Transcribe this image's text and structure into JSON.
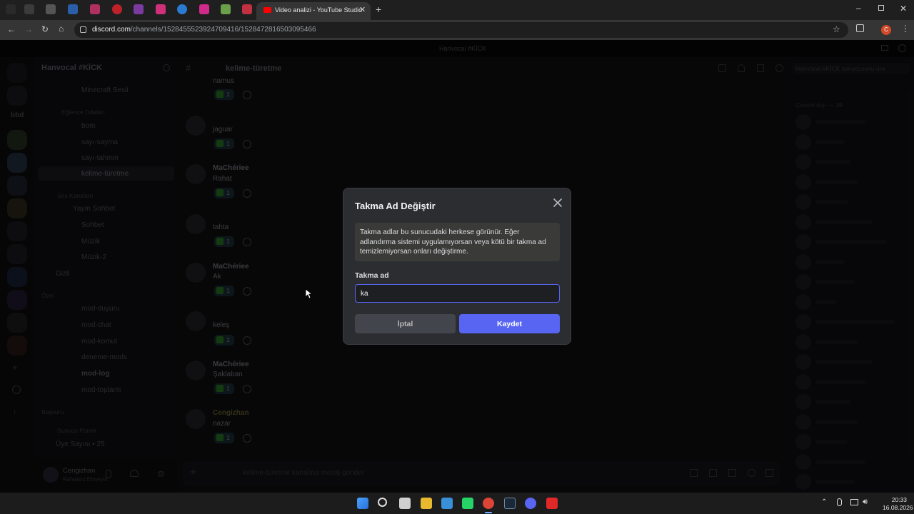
{
  "browser": {
    "active_tab_title": "Video analizi - YouTube Studio",
    "url_host": "discord.com",
    "url_path": "/channels/1528455523924709416/1528472816503095466",
    "profile_initial": "C"
  },
  "discord": {
    "window_title": "Hanvocal #KİCK",
    "server_name": "Hanvocal #KİCK",
    "current_channel": "kelime-türetme",
    "member_search_placeholder": "Hanvocal #KİCK sunucusunu ara",
    "channels": [
      {
        "label": "Minecraft Sesli"
      },
      {
        "label": "Eğlence Odaları"
      },
      {
        "label": "bom"
      },
      {
        "label": "sayı-sayma"
      },
      {
        "label": "sayı-tahmin"
      },
      {
        "label": "kelime-türetme"
      },
      {
        "label": "Ses Kanalları"
      },
      {
        "label": "Yayın Sohbet"
      },
      {
        "label": "Sohbet"
      },
      {
        "label": "Müzik"
      },
      {
        "label": "Müzik-2"
      },
      {
        "label": "Gizli"
      },
      {
        "label": "Özel"
      },
      {
        "label": "mod-duyuru"
      },
      {
        "label": "mod-chat"
      },
      {
        "label": "mod-komut"
      },
      {
        "label": "deneme-mods"
      },
      {
        "label": "mod-log"
      },
      {
        "label": "mod-toplantı"
      },
      {
        "label": "Başvuru"
      },
      {
        "label": "Sunucu Paneli"
      },
      {
        "label": "Üye Sayısı • 25"
      }
    ],
    "messages": [
      {
        "author": "",
        "text": "namus",
        "count": "1"
      },
      {
        "author": "",
        "text": "jaguar",
        "count": "1"
      },
      {
        "author": "MaChériee",
        "text": "Rahat",
        "count": "1"
      },
      {
        "author": "",
        "text": "tahta",
        "count": "1"
      },
      {
        "author": "MaChériee",
        "text": "Ak",
        "count": "1"
      },
      {
        "author": "",
        "text": "keleş",
        "count": "1"
      },
      {
        "author": "MaChériee",
        "text": "Şaklaban",
        "count": "1"
      },
      {
        "author": "Cengizhan",
        "text": "nazar",
        "count": "1"
      }
    ],
    "user": {
      "name": "Cengizhan",
      "status": "Rahatsız Etmeyin"
    },
    "members_header": "Çevrim dışı — 19",
    "message_placeholder": "kelime-türetme kanalına mesaj gönder"
  },
  "modal": {
    "title": "Takma Ad Değiştir",
    "notice": "Takma adlar bu sunucudaki herkese görünür. Eğer adlandırma sistemi uygulamıyorsan veya kötü bir takma ad temizlemiyorsan onları değiştirme.",
    "field_label": "Takma ad",
    "input_value": "ka",
    "cancel_label": "İptal",
    "save_label": "Kaydet",
    "accent_color": "#5865f2"
  },
  "taskbar": {
    "time": "20:33",
    "date": "16.08.2026"
  }
}
